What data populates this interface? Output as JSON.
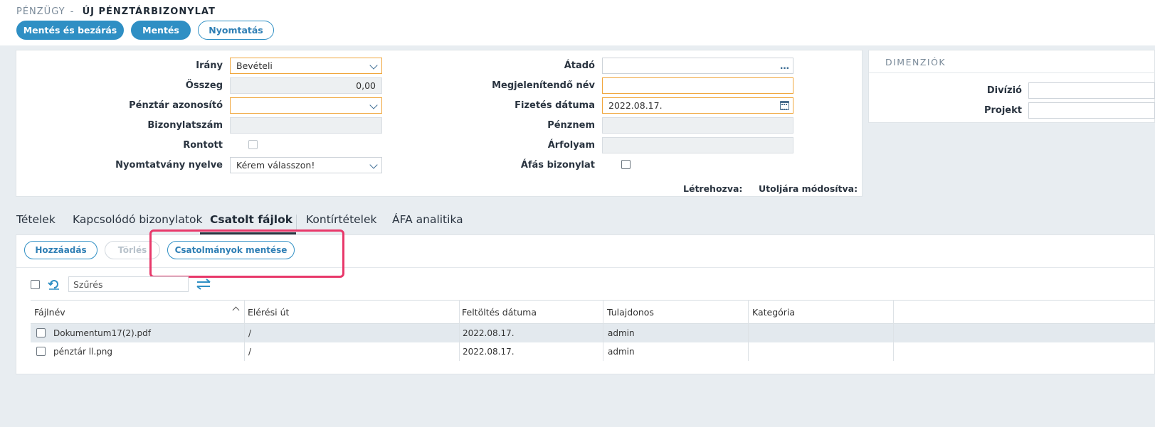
{
  "header": {
    "breadcrumb_parent": "PÉNZÜGY",
    "breadcrumb_sep": "-",
    "title": "ÚJ PÉNZTÁRBIZONYLAT",
    "buttons": {
      "save_close": "Mentés és bezárás",
      "save": "Mentés",
      "print": "Nyomtatás"
    }
  },
  "form": {
    "left": {
      "irany_label": "Irány",
      "irany_value": "Bevételi",
      "osszeg_label": "Összeg",
      "osszeg_value": "0,00",
      "penztar_label": "Pénztár azonosító",
      "penztar_value": "",
      "bizonylatszam_label": "Bizonylatszám",
      "bizonylatszam_value": "",
      "rontott_label": "Rontott",
      "nyelv_label": "Nyomtatvány nyelve",
      "nyelv_value": "Kérem válasszon!"
    },
    "right": {
      "atado_label": "Átadó",
      "atado_value": "",
      "megjelenitendo_label": "Megjelenítendő név",
      "megjelenitendo_value": "",
      "fizetes_label": "Fizetés dátuma",
      "fizetes_value": "2022.08.17.",
      "penznem_label": "Pénznem",
      "penznem_value": "",
      "arfolyam_label": "Árfolyam",
      "arfolyam_value": "",
      "afas_label": "Áfás bizonylat"
    },
    "meta": {
      "created_label": "Létrehozva:",
      "modified_label": "Utoljára módosítva:"
    }
  },
  "dimensions": {
    "title": "DIMENZIÓK",
    "divizio_label": "Divízió",
    "projekt_label": "Projekt"
  },
  "tabs": [
    {
      "label": "Tételek"
    },
    {
      "label": "Kapcsolódó bizonylatok"
    },
    {
      "label": "Csatolt fájlok",
      "active": true
    },
    {
      "label": "Kontírtételek"
    },
    {
      "label": "ÁFA analitika"
    }
  ],
  "attachments": {
    "toolbar": {
      "add": "Hozzáadás",
      "delete": "Törlés",
      "save_attachments": "Csatolmányok mentése"
    },
    "filter_placeholder": "Szűrés",
    "columns": [
      "Fájlnév",
      "Elérési út",
      "Feltöltés dátuma",
      "Tulajdonos",
      "Kategória"
    ],
    "rows": [
      {
        "name": "Dokumentum17(2).pdf",
        "path": "/",
        "date": "2022.08.17.",
        "owner": "admin",
        "category": ""
      },
      {
        "name": "pénztár ll.png",
        "path": "/",
        "date": "2022.08.17.",
        "owner": "admin",
        "category": ""
      }
    ]
  },
  "colors": {
    "accent": "#2f8fc4",
    "required_border": "#f0a63c",
    "highlight": "#e8386a"
  }
}
